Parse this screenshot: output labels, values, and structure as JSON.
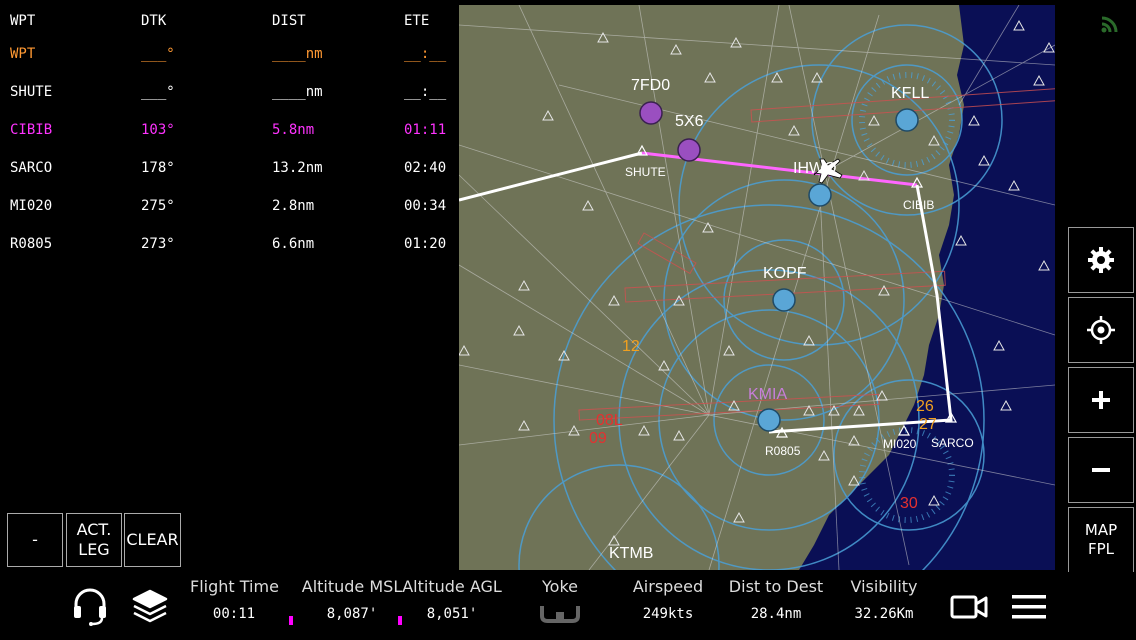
{
  "flightplan": {
    "headers": {
      "wpt": "WPT",
      "dtk": "DTK",
      "dist": "DIST",
      "ete": "ETE"
    },
    "rows": [
      {
        "wpt": "WPT",
        "dtk": "___°",
        "dist": "____nm",
        "ete": "__:__",
        "color": "#ff9933"
      },
      {
        "wpt": "SHUTE",
        "dtk": "___°",
        "dist": "____nm",
        "ete": "__:__",
        "color": "#ffffff"
      },
      {
        "wpt": "CIBIB",
        "dtk": "103°",
        "dist": "5.8nm",
        "ete": "01:11",
        "color": "#ff33ff"
      },
      {
        "wpt": "SARCO",
        "dtk": "178°",
        "dist": "13.2nm",
        "ete": "02:40",
        "color": "#ffffff"
      },
      {
        "wpt": "MI020",
        "dtk": "275°",
        "dist": "2.8nm",
        "ete": "00:34",
        "color": "#ffffff"
      },
      {
        "wpt": "R0805",
        "dtk": "273°",
        "dist": "6.6nm",
        "ete": "01:20",
        "color": "#ffffff"
      }
    ],
    "buttons": {
      "minus": "-",
      "act_leg": "ACT.\nLEG",
      "clear": "CLEAR"
    }
  },
  "map": {
    "labels": {
      "fd": "7FD0",
      "fivex": "5X6",
      "kfll": "KFLL",
      "ihwo": "IHWO",
      "kopf": "KOPF",
      "kmia": "KMIA",
      "ktmb": "KTMB",
      "shute": "SHUTE",
      "cibib": "CIBIB",
      "sarco": "SARCO",
      "mi020": "MI020",
      "r0805": "R0805",
      "r12": "12",
      "r26": "26",
      "r27": "27",
      "r08": "08L",
      "r09": "09",
      "r30": "30"
    }
  },
  "controls": {
    "map_fpl_1": "MAP",
    "map_fpl_2": "FPL"
  },
  "stats": {
    "flight_time": {
      "label": "Flight Time",
      "value": "00:11"
    },
    "alt_msl": {
      "label": "Altitude MSL",
      "value": "8,087'"
    },
    "alt_agl": {
      "label": "Altitude AGL",
      "value": "8,051'"
    },
    "yoke": {
      "label": "Yoke"
    },
    "airspeed": {
      "label": "Airspeed",
      "value": "249kts"
    },
    "dist_dest": {
      "label": "Dist to Dest",
      "value": "28.4nm"
    },
    "visibility": {
      "label": "Visibility",
      "value": "32.26Km"
    }
  },
  "colors": {
    "active_leg": "#ff66ff",
    "route": "#ffffff",
    "land": "#6f7357",
    "water": "#0a0f55",
    "airport": "#5aa6d6"
  }
}
